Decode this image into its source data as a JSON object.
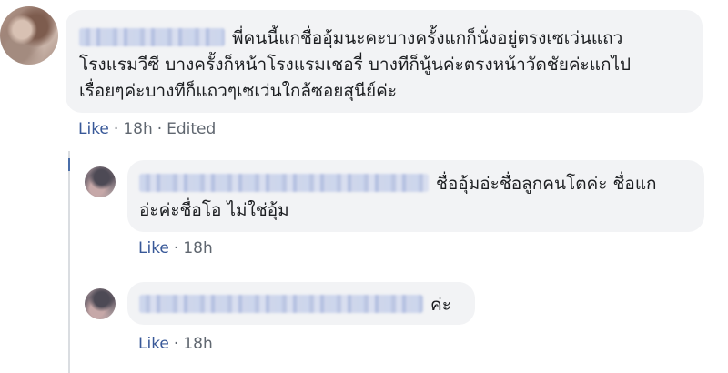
{
  "comments": [
    {
      "author_name": "",
      "text": "พี่คนนี้แกชื่ออุ้มนะคะบางครั้งแกก็นั่งอยู่ตรงเซเว่นแถว\nโรงแรมวีซี บางครั้งก็หน้าโรงแรมเชอรี่ บางทีก็นู้นค่ะตรงหน้าวัดชัยค่ะแกไป\nเรื่อยๆค่ะบางทีก็แถวๆเซเว่นใกล้ซอยสุนีย์ค่ะ",
      "like_label": "Like",
      "time": "18h",
      "edited_label": "Edited"
    }
  ],
  "replies": [
    {
      "author_name": "",
      "text": "ชื่ออุ้มอ่ะชื่อลูกคนโตค่ะ ชื่อแก\nอ่ะค่ะชื่อโอ ไม่ใช่อุ้ม",
      "like_label": "Like",
      "time": "18h"
    },
    {
      "author_name": "",
      "text": "ค่ะ",
      "like_label": "Like",
      "time": "18h"
    }
  ],
  "separator": "·",
  "colors": {
    "bubble": "#f2f3f5",
    "link": "#385898",
    "meta": "#606770",
    "text": "#1c1e21"
  }
}
